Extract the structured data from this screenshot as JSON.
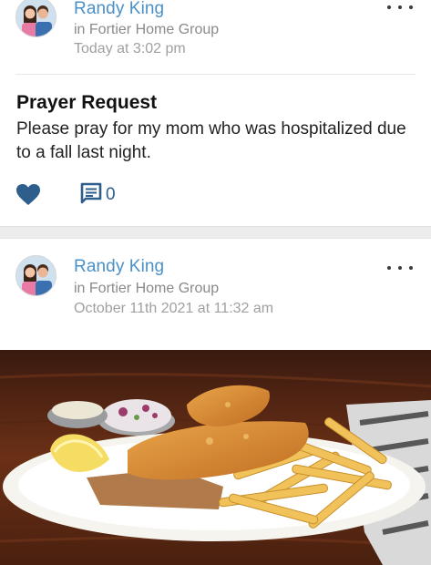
{
  "posts": [
    {
      "author": "Randy King",
      "group": "in Fortier Home Group",
      "time": "Today at 3:02 pm",
      "title": "Prayer Request",
      "body": "Please pray for my mom who was hospitalized due to a fall last night.",
      "comment_count": "0",
      "icons": {
        "like": "heart-icon",
        "comment": "comment-icon",
        "more": "more-options-icon"
      }
    },
    {
      "author": "Randy King",
      "group": "in Fortier Home Group",
      "time": "October 11th 2021 at 11:32 am",
      "image": "fish-and-chips-photo",
      "icons": {
        "more": "more-options-icon"
      }
    }
  ],
  "colors": {
    "author": "#4a90c8",
    "meta": "#8a8a8a",
    "like": "#2d5e8c",
    "comment": "#2d5e8c"
  }
}
